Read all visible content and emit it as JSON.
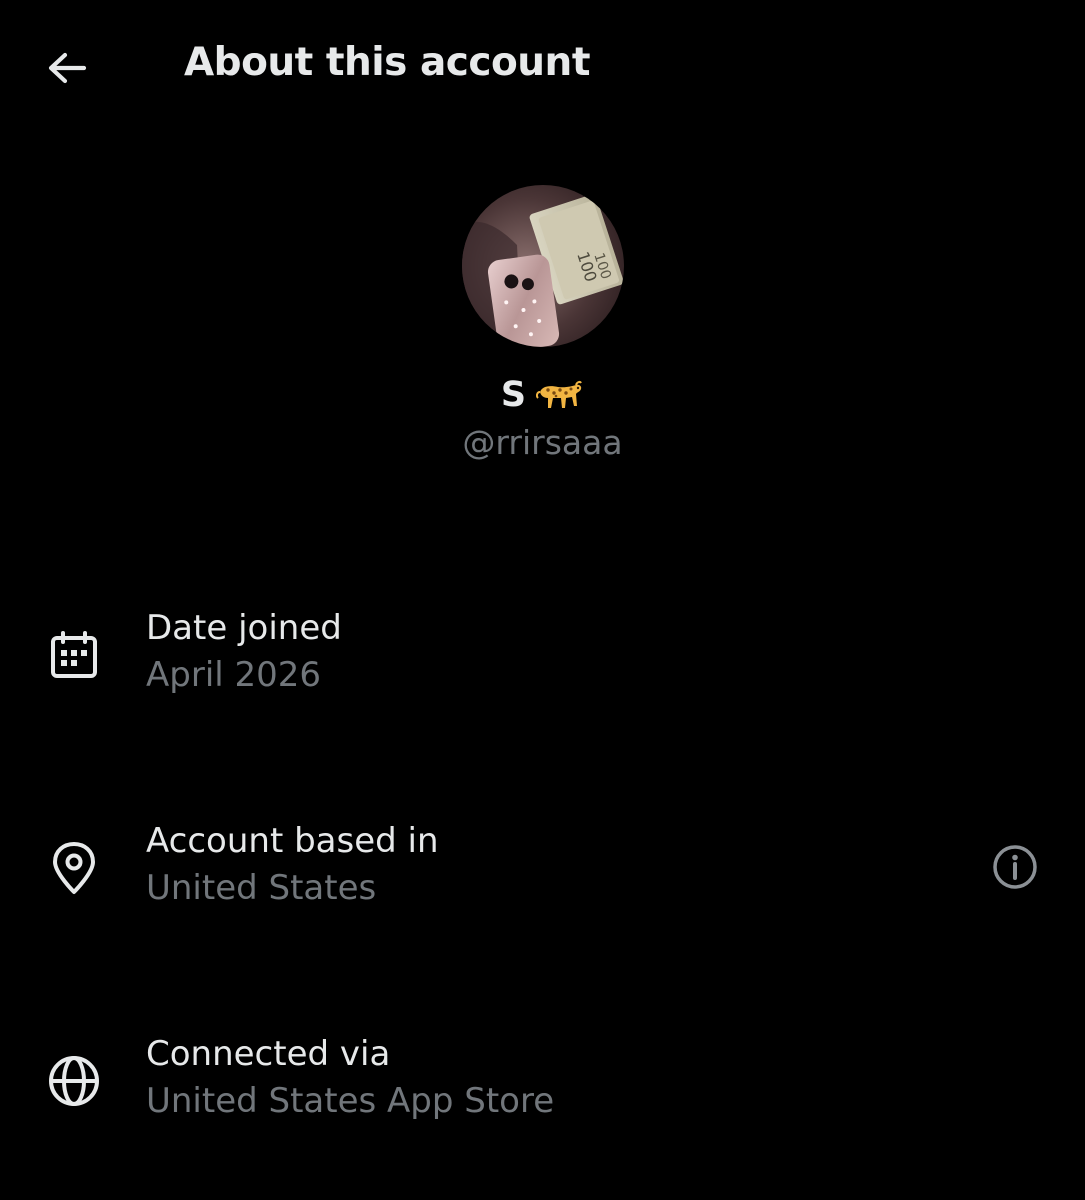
{
  "header": {
    "title": "About this account",
    "back_icon": "arrow-left-icon"
  },
  "profile": {
    "display_name": "S",
    "display_name_emoji": "leopard-emoji",
    "handle": "@rrirsaaa"
  },
  "details": [
    {
      "icon": "calendar-icon",
      "label": "Date joined",
      "value": "April 2026"
    },
    {
      "icon": "location-pin-icon",
      "label": "Account based in",
      "value": "United States",
      "action_icon": "info-icon"
    },
    {
      "icon": "globe-icon",
      "label": "Connected via",
      "value": "United States App Store"
    }
  ],
  "colors": {
    "background": "#000000",
    "primary_text": "#e7e9ea",
    "secondary_text": "#71767b"
  }
}
